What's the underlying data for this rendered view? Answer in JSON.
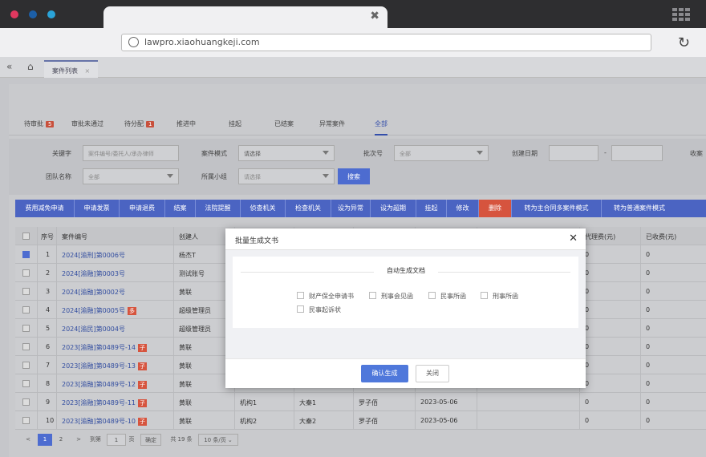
{
  "browser": {
    "url": "lawpro.xiaohuangkeji.com",
    "colors": {
      "close": "#e0385f",
      "minimize": "#1c5fa8",
      "maximize": "#2aa3d8"
    }
  },
  "apptabs": {
    "active": "案件列表"
  },
  "status_tabs": [
    {
      "label": "待审批",
      "badge": "5"
    },
    {
      "label": "审批未通过",
      "badge": ""
    },
    {
      "label": "待分配",
      "badge": "1"
    },
    {
      "label": "推进中",
      "badge": ""
    },
    {
      "label": "挂起",
      "badge": ""
    },
    {
      "label": "已结案",
      "badge": ""
    },
    {
      "label": "异常案件",
      "badge": ""
    },
    {
      "label": "全部",
      "badge": ""
    }
  ],
  "filters": {
    "keyword_label": "关键字",
    "keyword_placeholder": "案件编号/委托人/承办律师",
    "mode_label": "案件模式",
    "mode_value": "请选择",
    "batch_label": "批次号",
    "batch_value": "全部",
    "date_label": "创建日期",
    "date_sep": "-",
    "fee_label": "收案",
    "team_label": "团队名称",
    "team_value": "全部",
    "group_label": "所属小组",
    "group_value": "请选择",
    "search_btn": "搜索"
  },
  "actions": [
    "费用减免申请",
    "申请发票",
    "申请退费",
    "结案",
    "法院提醒",
    "侦查机关",
    "检查机关",
    "设为异常",
    "设为超期",
    "挂起",
    "修改",
    "删除",
    "转为主合同多案件模式",
    "转为普通案件模式"
  ],
  "table": {
    "headers": [
      "",
      "序号",
      "案件编号",
      "创建人",
      "",
      "",
      "",
      "",
      "代理费(元)",
      "已收费(元)"
    ],
    "rows": [
      {
        "no": "1",
        "code": "2024[渝刑]第0006号",
        "tag": "",
        "creator": "杨杰T",
        "org": "",
        "client": "",
        "lawyer": "",
        "date": "",
        "fee": "0",
        "paid": "0",
        "checked": true
      },
      {
        "no": "2",
        "code": "2024[渝融]第0003号",
        "tag": "",
        "creator": "测试账号",
        "org": "",
        "client": "",
        "lawyer": "",
        "date": "",
        "fee": "0",
        "paid": "0",
        "checked": false
      },
      {
        "no": "3",
        "code": "2024[渝融]第0002号",
        "tag": "",
        "creator": "黄联",
        "org": "",
        "client": "",
        "lawyer": "",
        "date": "",
        "fee": "0",
        "paid": "0",
        "checked": false
      },
      {
        "no": "4",
        "code": "2024[渝融]第0005号",
        "tag": "多",
        "creator": "超级管理员",
        "org": "",
        "client": "",
        "lawyer": "",
        "date": "",
        "fee": "0",
        "paid": "0",
        "checked": false
      },
      {
        "no": "5",
        "code": "2024[渝民]第0004号",
        "tag": "",
        "creator": "超级管理员",
        "org": "",
        "client": "",
        "lawyer": "",
        "date": "",
        "fee": "0",
        "paid": "0",
        "checked": false
      },
      {
        "no": "6",
        "code": "2023[渝融]第0489号-14",
        "tag": "子",
        "creator": "黄联",
        "org": "",
        "client": "",
        "lawyer": "",
        "date": "",
        "fee": "0",
        "paid": "0",
        "checked": false
      },
      {
        "no": "7",
        "code": "2023[渝融]第0489号-13",
        "tag": "子",
        "creator": "黄联",
        "org": "",
        "client": "",
        "lawyer": "",
        "date": "",
        "fee": "0",
        "paid": "0",
        "checked": false
      },
      {
        "no": "8",
        "code": "2023[渝融]第0489号-12",
        "tag": "子",
        "creator": "黄联",
        "org": "",
        "client": "",
        "lawyer": "",
        "date": "",
        "fee": "0",
        "paid": "0",
        "checked": false
      },
      {
        "no": "9",
        "code": "2023[渝融]第0489号-11",
        "tag": "子",
        "creator": "黄联",
        "org": "机构1",
        "client": "大秦1",
        "lawyer": "罗子佰",
        "date": "2023-05-06",
        "fee": "0",
        "paid": "0",
        "checked": false
      },
      {
        "no": "10",
        "code": "2023[渝融]第0489号-10",
        "tag": "子",
        "creator": "黄联",
        "org": "机构2",
        "client": "大秦2",
        "lawyer": "罗子佰",
        "date": "2023-05-06",
        "fee": "0",
        "paid": "0",
        "checked": false
      }
    ]
  },
  "pager": {
    "prev": "<",
    "p1": "1",
    "p2": "2",
    "next": ">",
    "goto": "到第",
    "page": "1",
    "page_unit": "页",
    "confirm": "确定",
    "total": "共 19 条",
    "size": "10 条/页"
  },
  "modal": {
    "title": "批量生成文书",
    "section": "自动生成文档",
    "options": [
      "财产保全申请书",
      "刑事会见函",
      "民事所函",
      "刑事所函",
      "民事起诉状"
    ],
    "ok": "确认生成",
    "cancel": "关闭"
  }
}
